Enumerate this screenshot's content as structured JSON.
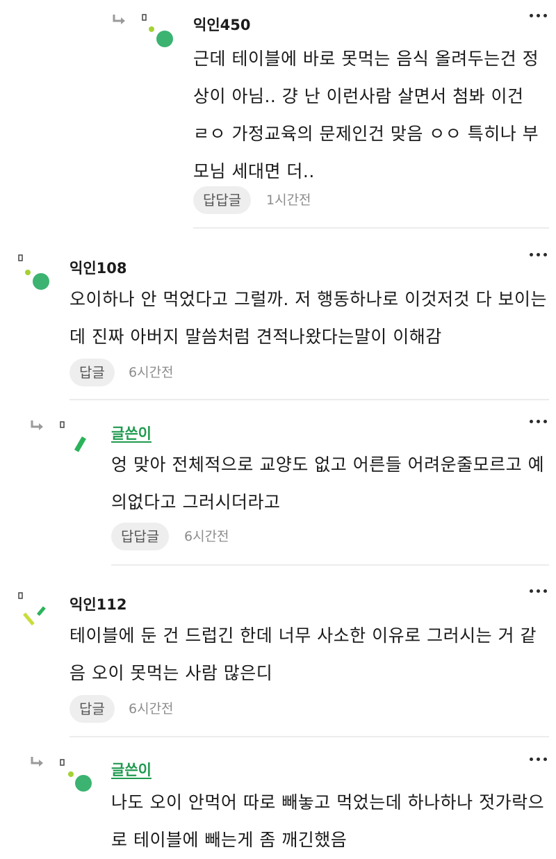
{
  "comments": [
    {
      "author": "익인450",
      "text": "근데 테이블에 바로 못먹는 음식 올려두는건 정상이 아님.. 걍 난 이런사람 살면서 첨봐 이건 ㄹㅇ 가정교육의 문제인건 맞음 ㅇㅇ 특히나 부모님 세대면 더..",
      "reply_label": "답답글",
      "time": "1시간전"
    },
    {
      "author": "익인108",
      "text": "오이하나 안 먹었다고 그럴까. 저 행동하나로 이것저것 다 보이는데 진짜 아버지 말씀처럼 견적나왔다는말이 이해감",
      "reply_label": "답글",
      "time": "6시간전"
    },
    {
      "author": "글쓴이",
      "text": "엉 맞아 전체적으로 교양도 없고 어른들 어려운줄모르고 예의없다고 그러시더라고",
      "reply_label": "답답글",
      "time": "6시간전"
    },
    {
      "author": "익인112",
      "text": "테이블에 둔 건 드럽긴 한데 너무 사소한 이유로 그러시는 거 같음 오이 못먹는 사람 많은디",
      "reply_label": "답글",
      "time": "6시간전"
    },
    {
      "author": "글쓴이",
      "text": "나도 오이 안먹어 따로 빼놓고 먹었는데 하나하나 젓가락으로 테이블에 빼는게 좀 깨긴했음"
    }
  ],
  "colors": {
    "avatar_green": "#3cb371",
    "avatar_lime": "#a4d233",
    "op_green": "#1f9a4f",
    "reply_bg": "#eeeeee"
  }
}
